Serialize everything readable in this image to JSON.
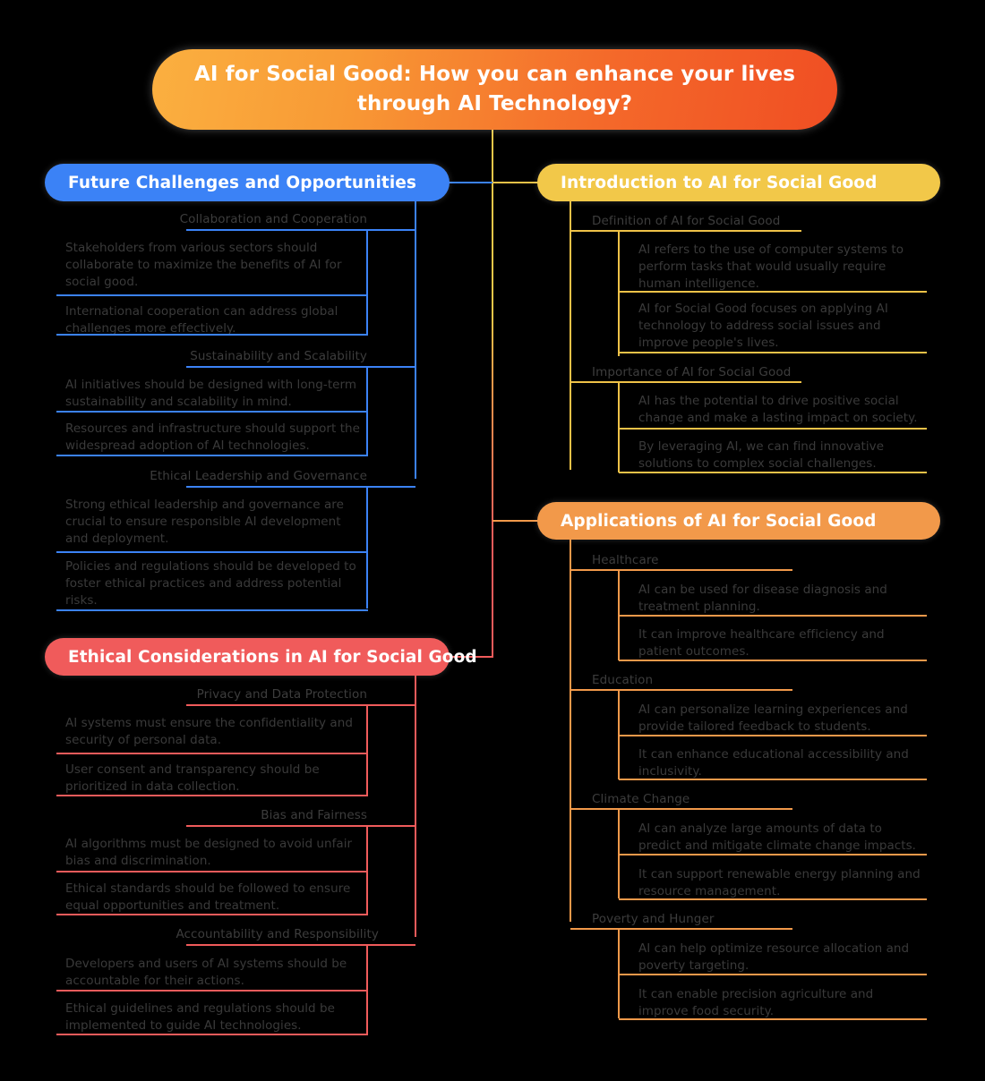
{
  "root": {
    "title": "AI for Social Good: How you can enhance your lives through  AI Technology?",
    "line1": "AI for Social Good: How you can enhance your lives",
    "line2": "through  AI Technology?",
    "gradient_from": "#FBB040",
    "gradient_to": "#F04E23"
  },
  "branches": [
    {
      "id": "future-challenges",
      "label": "Future Challenges and Opportunities",
      "color": "#3B82F6",
      "side": "left",
      "topics": [
        {
          "label": "Collaboration and Cooperation",
          "leaves": [
            "Stakeholders from various sectors should collaborate to maximize the benefits of AI for social good.",
            "International cooperation can address global challenges more effectively."
          ]
        },
        {
          "label": "Sustainability and Scalability",
          "leaves": [
            "AI initiatives should be designed with long-term sustainability and scalability in mind.",
            "Resources and infrastructure should support the widespread adoption of AI technologies."
          ]
        },
        {
          "label": "Ethical Leadership and Governance",
          "leaves": [
            "Strong ethical leadership and governance are crucial to ensure responsible AI development and deployment.",
            "Policies and regulations should be developed to foster ethical practices and address potential risks."
          ]
        }
      ]
    },
    {
      "id": "ethical-considerations",
      "label": "Ethical Considerations in AI for Social Good",
      "color": "#F05B5B",
      "side": "left",
      "topics": [
        {
          "label": "Privacy and Data Protection",
          "leaves": [
            "AI systems must ensure the confidentiality and security of personal data.",
            "User consent and transparency should be prioritized in data collection."
          ]
        },
        {
          "label": "Bias and Fairness",
          "leaves": [
            "AI algorithms must be designed to avoid unfair bias and discrimination.",
            " Ethical standards should be followed to ensure equal opportunities and treatment."
          ]
        },
        {
          "label": "Accountability and Responsibility",
          "leaves": [
            "Developers and users of AI systems should be accountable for their actions.",
            "Ethical guidelines and regulations should be implemented to guide AI technologies."
          ]
        }
      ]
    },
    {
      "id": "introduction",
      "label": "Introduction to AI for Social Good",
      "color": "#F2C849",
      "side": "right",
      "topics": [
        {
          "label": "Definition of AI for Social Good",
          "leaves": [
            "AI refers to the use of computer systems to perform tasks that would usually require human intelligence.",
            "AI for Social Good focuses on applying AI technology to address social issues and improve people's lives."
          ]
        },
        {
          "label": "Importance of AI for Social Good",
          "leaves": [
            "AI has the potential to drive positive social change and make a lasting impact on society.",
            "By leveraging AI, we can find innovative solutions to complex social challenges."
          ]
        }
      ]
    },
    {
      "id": "applications",
      "label": "Applications of AI for Social Good",
      "color": "#F2994A",
      "side": "right",
      "topics": [
        {
          "label": "Healthcare",
          "leaves": [
            "AI can be used for disease diagnosis and treatment planning.",
            "It can improve healthcare efficiency and patient outcomes."
          ]
        },
        {
          "label": "Education",
          "leaves": [
            "AI can personalize learning experiences and provide tailored feedback to students.",
            "It can enhance educational accessibility and inclusivity."
          ]
        },
        {
          "label": "Climate Change",
          "leaves": [
            "AI can analyze large amounts of data to predict and mitigate climate change impacts.",
            "It can support renewable energy planning and resource management."
          ]
        },
        {
          "label": "Poverty and Hunger",
          "leaves": [
            "AI can help optimize resource allocation and poverty targeting.",
            "It can enable precision agriculture and improve food security."
          ]
        }
      ]
    }
  ]
}
